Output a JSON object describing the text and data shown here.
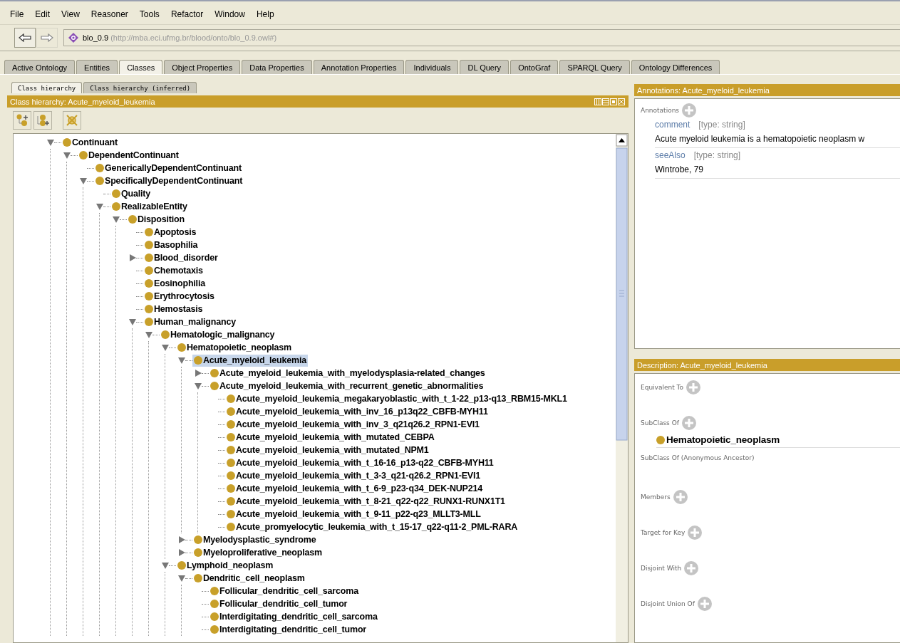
{
  "menu": [
    "File",
    "Edit",
    "View",
    "Reasoner",
    "Tools",
    "Refactor",
    "Window",
    "Help"
  ],
  "address": {
    "name": "blo_0.9",
    "iri": "(http://mba.eci.ufmg.br/blood/onto/blo_0.9.owl#)"
  },
  "tabs": [
    {
      "label": "Active Ontology",
      "selected": false
    },
    {
      "label": "Entities",
      "selected": false
    },
    {
      "label": "Classes",
      "selected": true
    },
    {
      "label": "Object Properties",
      "selected": false
    },
    {
      "label": "Data Properties",
      "selected": false
    },
    {
      "label": "Annotation Properties",
      "selected": false
    },
    {
      "label": "Individuals",
      "selected": false
    },
    {
      "label": "DL Query",
      "selected": false
    },
    {
      "label": "OntoGraf",
      "selected": false
    },
    {
      "label": "SPARQL Query",
      "selected": false
    },
    {
      "label": "Ontology Differences",
      "selected": false
    }
  ],
  "hierarchy": {
    "subtabs": [
      {
        "label": "Class hierarchy",
        "selected": true
      },
      {
        "label": "Class hierarchy (inferred)",
        "selected": false
      }
    ],
    "title": "Class hierarchy: Acute_myeloid_leukemia",
    "tree": [
      {
        "label": "Continuant",
        "expanded": true,
        "selected": false,
        "children": [
          {
            "label": "DependentContinuant",
            "expanded": true,
            "selected": false,
            "children": [
              {
                "label": "GenericallyDependentContinuant",
                "selected": false
              },
              {
                "label": "SpecificallyDependentContinuant",
                "expanded": true,
                "selected": false,
                "children": [
                  {
                    "label": "Quality",
                    "selected": false
                  },
                  {
                    "label": "RealizableEntity",
                    "expanded": true,
                    "selected": false,
                    "children": [
                      {
                        "label": "Disposition",
                        "expanded": true,
                        "selected": false,
                        "children": [
                          {
                            "label": "Apoptosis",
                            "selected": false
                          },
                          {
                            "label": "Basophilia",
                            "selected": false
                          },
                          {
                            "label": "Blood_disorder",
                            "expanded": false,
                            "selected": false
                          },
                          {
                            "label": "Chemotaxis",
                            "selected": false
                          },
                          {
                            "label": "Eosinophilia",
                            "selected": false
                          },
                          {
                            "label": "Erythrocytosis",
                            "selected": false
                          },
                          {
                            "label": "Hemostasis",
                            "selected": false
                          },
                          {
                            "label": "Human_malignancy",
                            "expanded": true,
                            "selected": false,
                            "children": [
                              {
                                "label": "Hematologic_malignancy",
                                "expanded": true,
                                "selected": false,
                                "children": [
                                  {
                                    "label": "Hematopoietic_neoplasm",
                                    "expanded": true,
                                    "selected": false,
                                    "children": [
                                      {
                                        "label": "Acute_myeloid_leukemia",
                                        "expanded": true,
                                        "selected": true,
                                        "children": [
                                          {
                                            "label": "Acute_myeloid_leukemia_with_myelodysplasia-related_changes",
                                            "expanded": false,
                                            "selected": false
                                          },
                                          {
                                            "label": "Acute_myeloid_leukemia_with_recurrent_genetic_abnormalities",
                                            "expanded": true,
                                            "selected": false,
                                            "children": [
                                              {
                                                "label": "Acute_myeloid_leukemia_megakaryoblastic_with_t_1-22_p13-q13_RBM15-MKL1",
                                                "selected": false
                                              },
                                              {
                                                "label": "Acute_myeloid_leukemia_with_inv_16_p13q22_CBFB-MYH11",
                                                "selected": false
                                              },
                                              {
                                                "label": "Acute_myeloid_leukemia_with_inv_3_q21q26.2_RPN1-EVI1",
                                                "selected": false
                                              },
                                              {
                                                "label": "Acute_myeloid_leukemia_with_mutated_CEBPA",
                                                "selected": false
                                              },
                                              {
                                                "label": "Acute_myeloid_leukemia_with_mutated_NPM1",
                                                "selected": false
                                              },
                                              {
                                                "label": "Acute_myeloid_leukemia_with_t_16-16_p13-q22_CBFB-MYH11",
                                                "selected": false
                                              },
                                              {
                                                "label": "Acute_myeloid_leukemia_with_t_3-3_q21-q26.2_RPN1-EVI1",
                                                "selected": false
                                              },
                                              {
                                                "label": "Acute_myeloid_leukemia_with_t_6-9_p23-q34_DEK-NUP214",
                                                "selected": false
                                              },
                                              {
                                                "label": "Acute_myeloid_leukemia_with_t_8-21_q22-q22_RUNX1-RUNX1T1",
                                                "selected": false
                                              },
                                              {
                                                "label": "Acute_myeloid_leukemia_with_t_9-11_p22-q23_MLLT3-MLL",
                                                "selected": false
                                              },
                                              {
                                                "label": "Acute_promyelocytic_leukemia_with_t_15-17_q22-q11-2_PML-RARA",
                                                "selected": false
                                              }
                                            ]
                                          }
                                        ]
                                      },
                                      {
                                        "label": "Myelodysplastic_syndrome",
                                        "expanded": false,
                                        "selected": false
                                      },
                                      {
                                        "label": "Myeloproliferative_neoplasm",
                                        "expanded": false,
                                        "selected": false
                                      }
                                    ]
                                  },
                                  {
                                    "label": "Lymphoid_neoplasm",
                                    "expanded": true,
                                    "selected": false,
                                    "children": [
                                      {
                                        "label": "Dendritic_cell_neoplasm",
                                        "expanded": true,
                                        "selected": false,
                                        "children": [
                                          {
                                            "label": "Follicular_dendritic_cell_sarcoma",
                                            "selected": false
                                          },
                                          {
                                            "label": "Follicular_dendritic_cell_tumor",
                                            "selected": false
                                          },
                                          {
                                            "label": "Interdigitating_dendritic_cell_sarcoma",
                                            "selected": false
                                          },
                                          {
                                            "label": "Interdigitating_dendritic_cell_tumor",
                                            "selected": false
                                          }
                                        ]
                                      }
                                    ]
                                  }
                                ]
                              }
                            ]
                          }
                        ]
                      }
                    ]
                  }
                ]
              }
            ]
          }
        ]
      }
    ]
  },
  "annotations": {
    "title": "Annotations: Acute_myeloid_leukemia",
    "label": "Annotations",
    "items": [
      {
        "property": "comment",
        "type": "[type: string]",
        "value": "Acute myeloid leukemia is a hematopoietic neoplasm w"
      },
      {
        "property": "seeAlso",
        "type": "[type: string]",
        "value": "Wintrobe, 79"
      }
    ]
  },
  "description": {
    "title": "Description: Acute_myeloid_leukemia",
    "sections": [
      {
        "label": "Equivalent To",
        "add_button": true
      },
      {
        "label": "SubClass Of",
        "add_button": true,
        "items": [
          "Hematopoietic_neoplasm"
        ]
      },
      {
        "label": "SubClass Of (Anonymous Ancestor)",
        "add_button": false
      },
      {
        "label": "Members",
        "add_button": true
      },
      {
        "label": "Target for Key",
        "add_button": true
      },
      {
        "label": "Disjoint With",
        "add_button": true
      },
      {
        "label": "Disjoint Union Of",
        "add_button": true
      }
    ]
  }
}
